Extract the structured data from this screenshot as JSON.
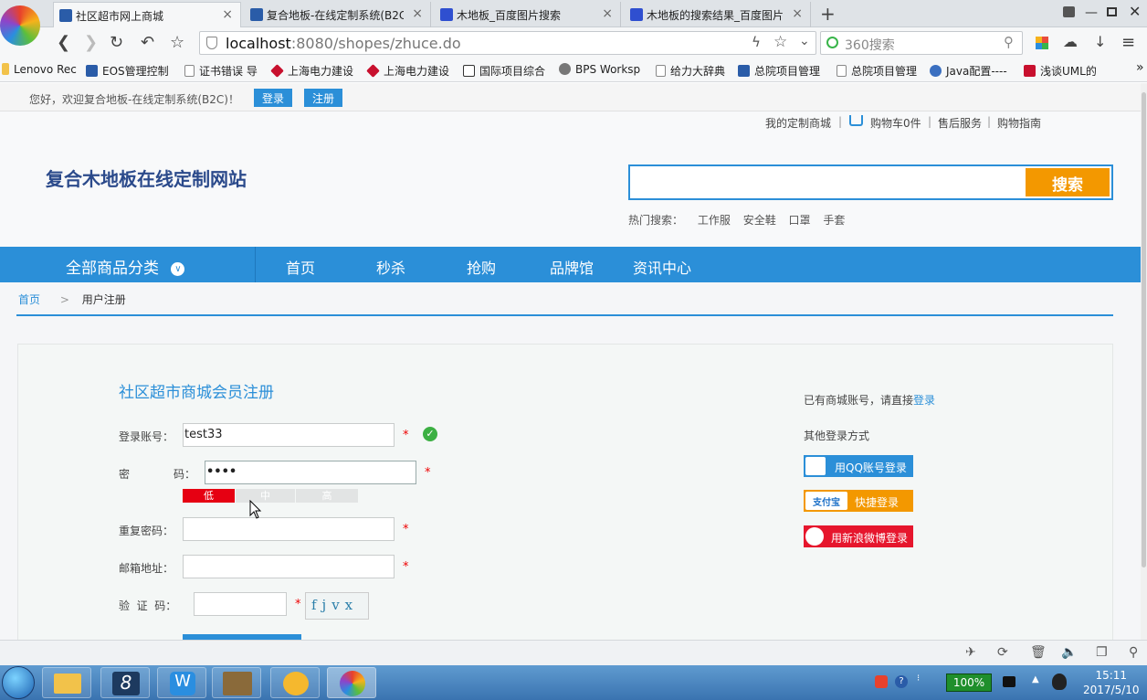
{
  "browser": {
    "tabs": [
      {
        "title": "社区超市网上商城",
        "active": true,
        "icon": "site-icon"
      },
      {
        "title": "复合地板-在线定制系统(B2C",
        "active": false,
        "icon": "site-icon"
      },
      {
        "title": "木地板_百度图片搜索",
        "active": false,
        "icon": "baidu-paw-icon"
      },
      {
        "title": "木地板的搜索结果_百度图片",
        "active": false,
        "icon": "baidu-paw-icon"
      }
    ],
    "new_tab": "+",
    "url_host": "localhost",
    "url_path": ":8080/shopes/zhuce.do",
    "search_placeholder": "360搜索",
    "bookmarks": [
      "Lenovo Rec",
      "EOS管理控制",
      "证书错误 导",
      "上海电力建设",
      "上海电力建设",
      "国际项目综合",
      "BPS Worksp",
      "给力大辞典",
      "总院项目管理",
      "总院项目管理",
      "Java配置----",
      "浅谈UML的"
    ],
    "bookmarks_more": "»"
  },
  "page": {
    "welcome": "您好，欢迎复合地板-在线定制系统(B2C)！",
    "login_btn": "登录",
    "register_btn": "注册",
    "toplinks": [
      "我的定制商城",
      "购物车0件",
      "售后服务",
      "购物指南"
    ],
    "site_title": "复合木地板在线定制网站",
    "search_btn": "搜索",
    "hot_label": "热门搜索：",
    "hot_terms": [
      "工作服",
      "安全鞋",
      "口罩",
      "手套"
    ],
    "all_categories": "全部商品分类",
    "nav": [
      "首页",
      "秒杀",
      "抢购",
      "品牌馆",
      "资讯中心"
    ],
    "breadcrumb": {
      "home": "首页",
      "sep": ">",
      "current": "用户注册"
    },
    "form": {
      "title": "社区超市商城会员注册",
      "account_label": "登录账号：",
      "account_value": "test33",
      "password_label_1": "密",
      "password_label_2": "码：",
      "password_value": "••••",
      "strength": [
        "低",
        "中",
        "高"
      ],
      "repeat_label": "重复密码：",
      "email_label": "邮箱地址：",
      "captcha_label": "验  证  码：",
      "captcha_text": "fjvx",
      "required_mark": "*"
    },
    "side": {
      "have_account": "已有商城账号，请直接",
      "login_link": "登录",
      "other_login": "其他登录方式",
      "qq_login": "用QQ账号登录",
      "alipay_brand": "支付宝",
      "alipay_login": "快捷登录",
      "weibo_login": "用新浪微博登录"
    }
  },
  "taskbar": {
    "battery": "100%",
    "time": "15:11",
    "date": "2017/5/10"
  },
  "colors": {
    "accent": "#2b8fd8",
    "search_orange": "#f39800",
    "required_red": "#e00000",
    "strength_low": "#e60012"
  }
}
